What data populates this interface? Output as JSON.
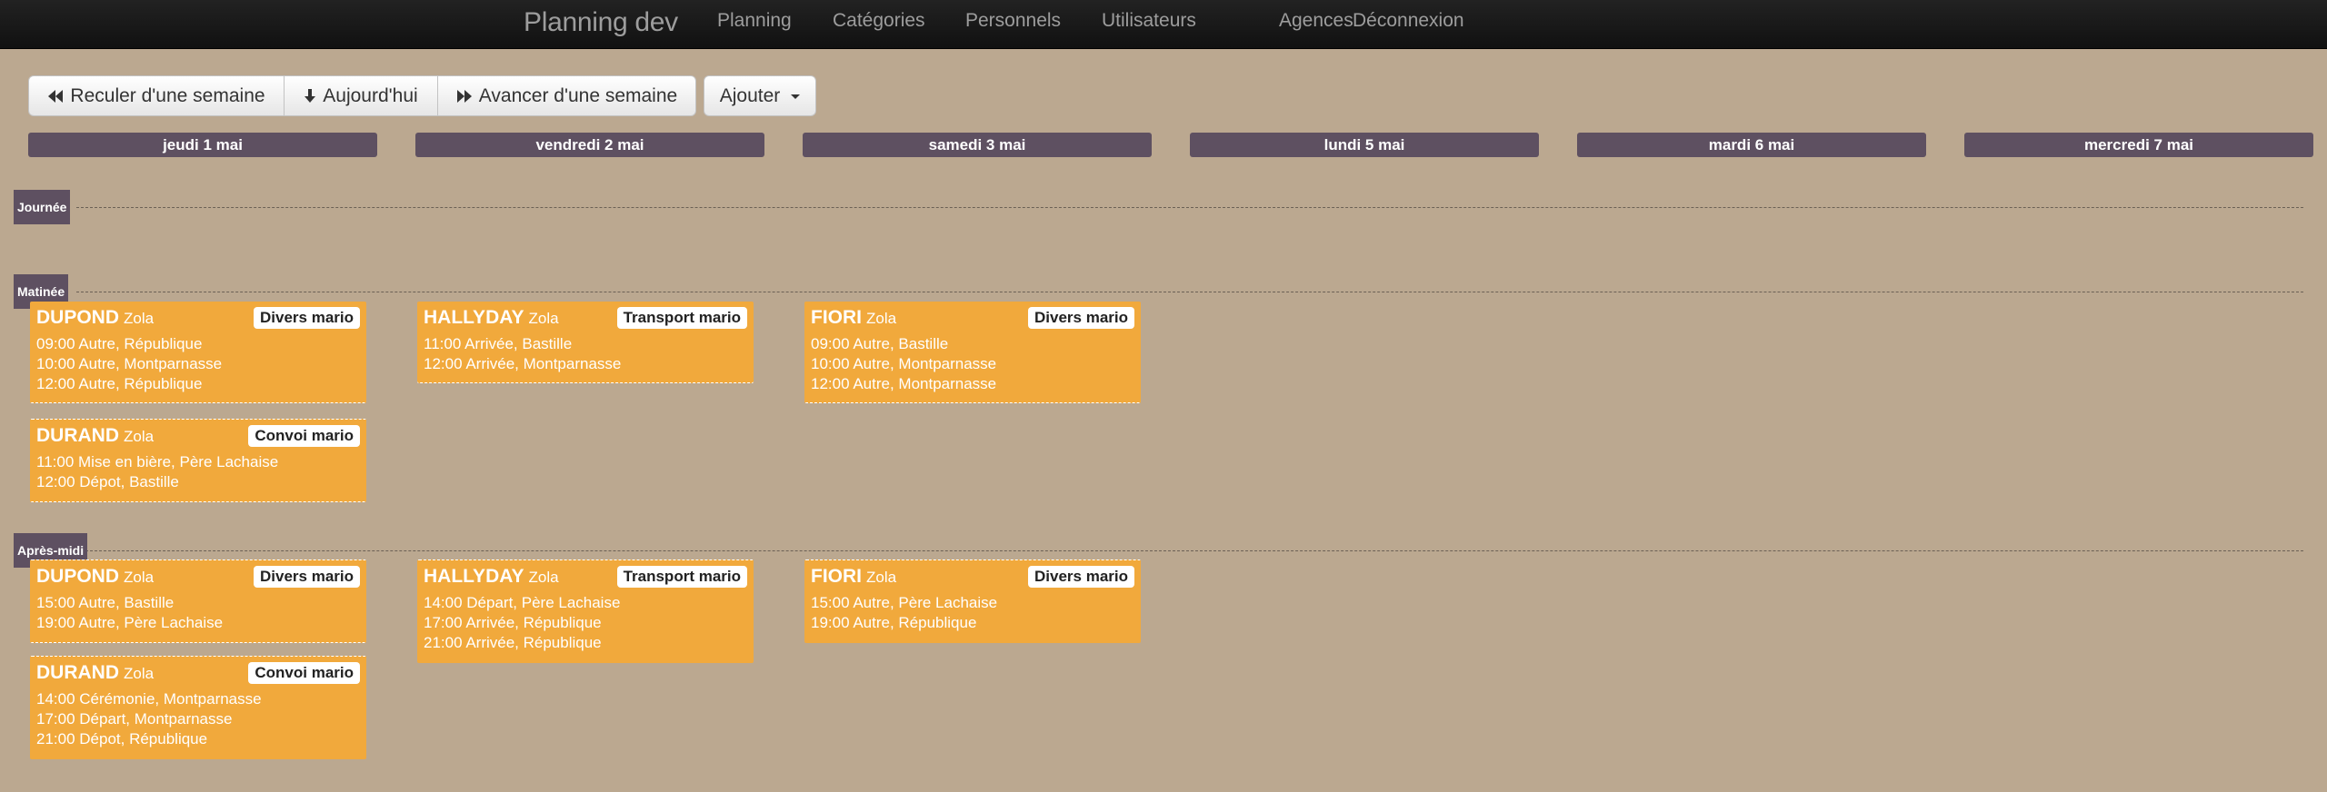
{
  "nav": {
    "brand": "Planning dev",
    "items": [
      "Planning",
      "Catégories",
      "Personnels",
      "Utilisateurs",
      "Agences",
      "Déconnexion"
    ]
  },
  "toolbar": {
    "back": "Reculer d'une semaine",
    "today": "Aujourd'hui",
    "forward": "Avancer d'une semaine",
    "add": "Ajouter"
  },
  "days": [
    "jeudi 1 mai",
    "vendredi 2 mai",
    "samedi 3 mai",
    "lundi 5 mai",
    "mardi 6 mai",
    "mercredi 7 mai"
  ],
  "sections": {
    "day": "Journée",
    "morning": "Matinée",
    "afternoon": "Après-midi"
  },
  "cards": [
    {
      "id": "m-dupond",
      "last": "DUPOND",
      "first": "Zola",
      "badge": "Divers mario",
      "lines": [
        "09:00 Autre, République",
        "10:00 Autre, Montparnasse",
        "12:00 Autre, République"
      ]
    },
    {
      "id": "m-durand",
      "last": "DURAND",
      "first": "Zola",
      "badge": "Convoi mario",
      "lines": [
        "11:00 Mise en bière, Père Lachaise",
        "12:00 Dépot, Bastille"
      ]
    },
    {
      "id": "m-hallyday",
      "last": "HALLYDAY",
      "first": "Zola",
      "badge": "Transport mario",
      "lines": [
        "11:00 Arrivée, Bastille",
        "12:00 Arrivée, Montparnasse"
      ]
    },
    {
      "id": "m-fiori",
      "last": "FIORI",
      "first": "Zola",
      "badge": "Divers mario",
      "lines": [
        "09:00 Autre, Bastille",
        "10:00 Autre, Montparnasse",
        "12:00 Autre, Montparnasse"
      ]
    },
    {
      "id": "a-dupond",
      "last": "DUPOND",
      "first": "Zola",
      "badge": "Divers mario",
      "lines": [
        "15:00 Autre, Bastille",
        "19:00 Autre, Père Lachaise"
      ]
    },
    {
      "id": "a-durand",
      "last": "DURAND",
      "first": "Zola",
      "badge": "Convoi mario",
      "lines": [
        "14:00 Cérémonie, Montparnasse",
        "17:00 Départ, Montparnasse",
        "21:00 Dépot, République"
      ]
    },
    {
      "id": "a-hallyday",
      "last": "HALLYDAY",
      "first": "Zola",
      "badge": "Transport mario",
      "lines": [
        "14:00 Départ, Père Lachaise",
        "17:00 Arrivée, République",
        "21:00 Arrivée, République"
      ]
    },
    {
      "id": "a-fiori",
      "last": "FIORI",
      "first": "Zola",
      "badge": "Divers mario",
      "lines": [
        "15:00 Autre, Père Lachaise",
        "19:00 Autre, République"
      ]
    }
  ]
}
